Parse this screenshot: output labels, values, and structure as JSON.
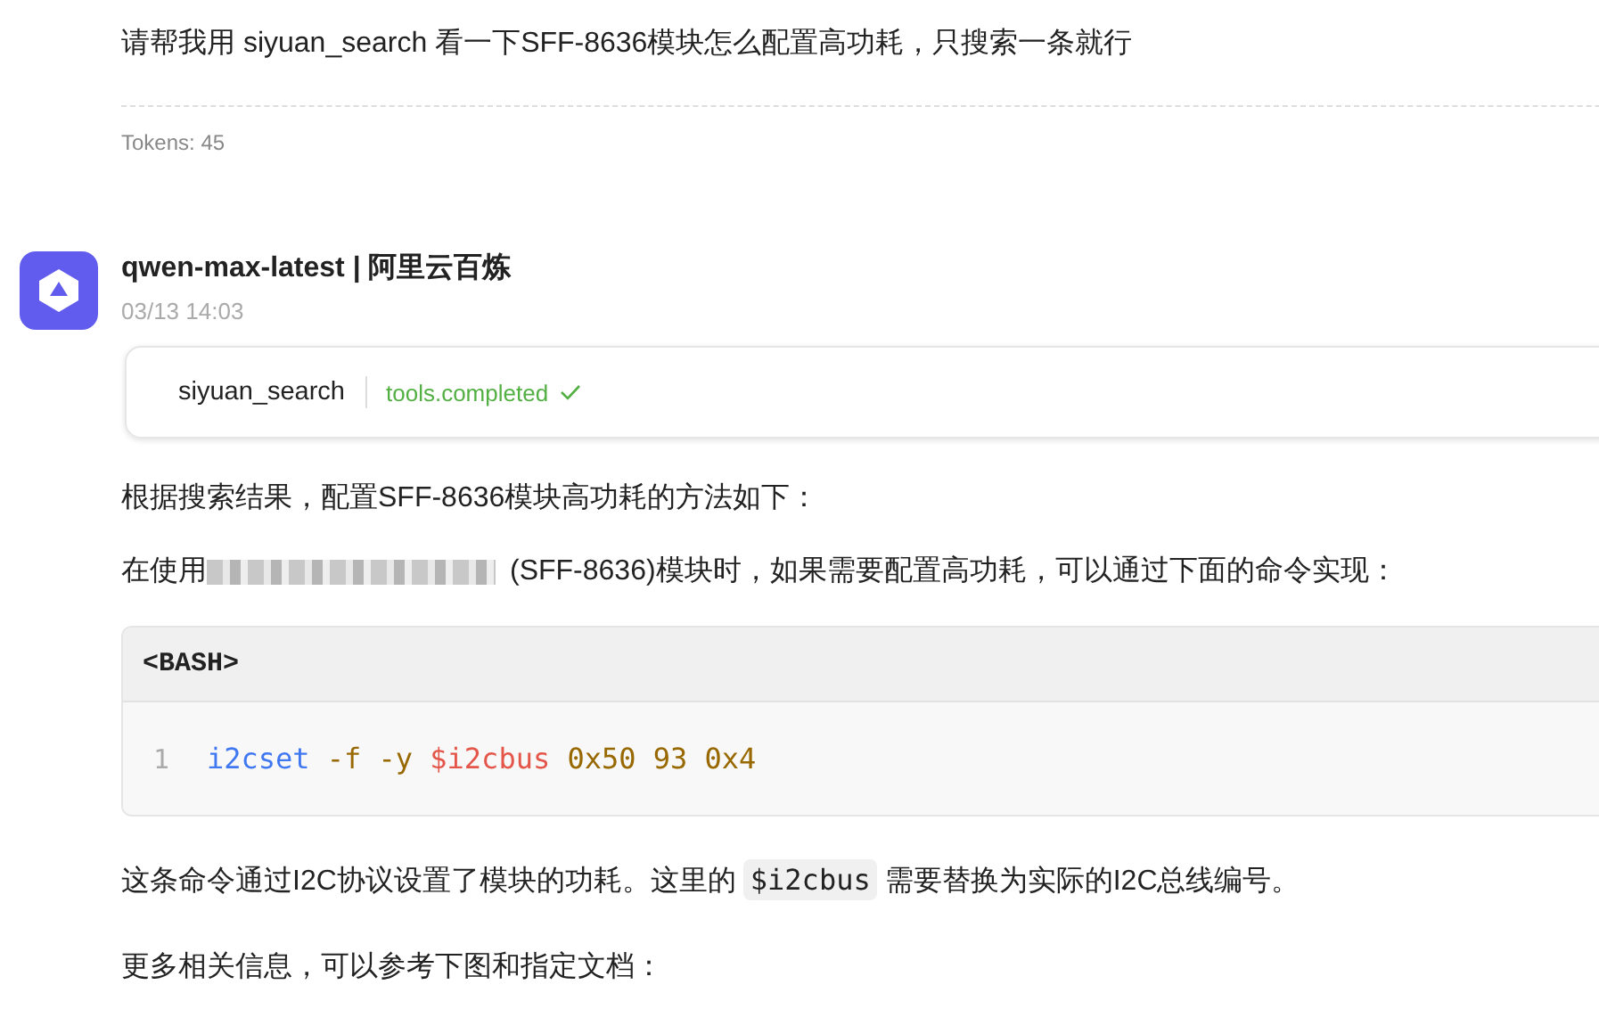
{
  "user_message": {
    "text": "请帮我用 siyuan_search 看一下SFF-8636模块怎么配置高功耗，只搜索一条就行",
    "tokens": "Tokens: 45"
  },
  "reply": {
    "model": "qwen-max-latest | 阿里云百炼",
    "time": "03/13 14:03",
    "tool_call": {
      "name": "siyuan_search",
      "status": "tools.completed",
      "completed": true
    },
    "intro": "根据搜索结果，配置SFF-8636模块高功耗的方法如下：",
    "usage": {
      "before": "在使用",
      "redacted": true,
      "after": "(SFF-8636)模块时，如果需要配置高功耗，可以通过下面的命令实现："
    },
    "code_block": {
      "language": "<BASH>",
      "lines": [
        {
          "number": "1",
          "tokens": [
            {
              "text": "i2cset",
              "kind": "command"
            },
            {
              "text": "-f -y",
              "kind": "flag"
            },
            {
              "text": "$i2cbus",
              "kind": "variable"
            },
            {
              "text": "0x50 93 0x4",
              "kind": "number"
            }
          ]
        }
      ]
    },
    "explanation": [
      {
        "text": "这条命令通过I2C协议设置了模块的功耗。这里的",
        "kind": "text"
      },
      {
        "text": "$i2cbus",
        "kind": "code"
      },
      {
        "text": "需要替换为实际的I2C总线编号。",
        "kind": "text"
      }
    ],
    "more": "更多相关信息，可以参考下图和指定文档："
  }
}
